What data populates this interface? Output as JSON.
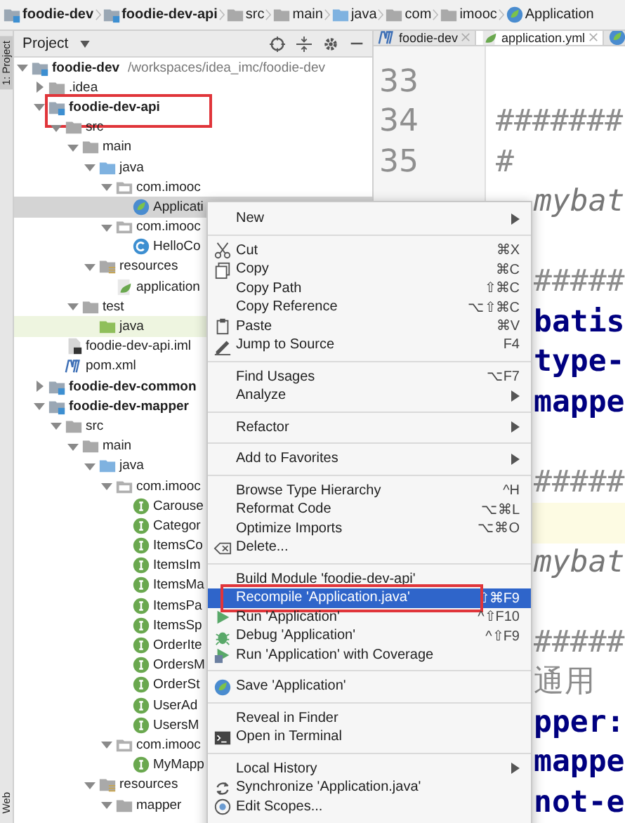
{
  "breadcrumbs": [
    {
      "label": "foodie-dev",
      "kind": "module"
    },
    {
      "label": "foodie-dev-api",
      "kind": "module"
    },
    {
      "label": "src",
      "kind": "folder"
    },
    {
      "label": "main",
      "kind": "folder"
    },
    {
      "label": "java",
      "kind": "src-folder"
    },
    {
      "label": "com",
      "kind": "folder"
    },
    {
      "label": "imooc",
      "kind": "folder"
    },
    {
      "label": "Application",
      "kind": "spring"
    }
  ],
  "tool_strip": [
    {
      "label": "1: Project",
      "selected": true
    },
    {
      "label": "Web",
      "selected": false
    }
  ],
  "project_panel": {
    "title": "Project",
    "tree": [
      {
        "label": "foodie-dev",
        "path": "/workspaces/idea_imc/foodie-dev",
        "kind": "module",
        "expanded": true,
        "selected": false,
        "children": [
          {
            "label": ".idea",
            "kind": "folder",
            "expanded": false,
            "selected": false
          },
          {
            "label": "foodie-dev-api",
            "kind": "module",
            "expanded": true,
            "selected": false,
            "marked": true,
            "children": [
              {
                "label": "src",
                "kind": "folder",
                "expanded": true,
                "selected": false,
                "children": [
                  {
                    "label": "main",
                    "kind": "folder",
                    "expanded": true,
                    "selected": false,
                    "children": [
                      {
                        "label": "java",
                        "kind": "src-folder",
                        "expanded": true,
                        "selected": false,
                        "children": [
                          {
                            "label": "com.imooc",
                            "kind": "package",
                            "expanded": true,
                            "selected": false,
                            "children": [
                              {
                                "label": "Applicati",
                                "kind": "spring",
                                "selected": true
                              }
                            ]
                          },
                          {
                            "label": "com.imooc",
                            "kind": "package",
                            "expanded": true,
                            "selected": false,
                            "children": [
                              {
                                "label": "HelloCo",
                                "kind": "class",
                                "selected": false
                              }
                            ]
                          }
                        ]
                      },
                      {
                        "label": "resources",
                        "kind": "res-folder",
                        "expanded": true,
                        "selected": false,
                        "children": [
                          {
                            "label": "application",
                            "kind": "yml",
                            "selected": false
                          }
                        ]
                      }
                    ]
                  },
                  {
                    "label": "test",
                    "kind": "folder",
                    "expanded": true,
                    "selected": false,
                    "children": [
                      {
                        "label": "java",
                        "kind": "test-folder",
                        "selected": false
                      }
                    ]
                  }
                ]
              },
              {
                "label": "foodie-dev-api.iml",
                "kind": "iml",
                "selected": false
              },
              {
                "label": "pom.xml",
                "kind": "pom",
                "selected": false
              }
            ]
          },
          {
            "label": "foodie-dev-common",
            "kind": "module",
            "expanded": false,
            "selected": false
          },
          {
            "label": "foodie-dev-mapper",
            "kind": "module",
            "expanded": true,
            "selected": false,
            "children": [
              {
                "label": "src",
                "kind": "folder",
                "expanded": true,
                "selected": false,
                "children": [
                  {
                    "label": "main",
                    "kind": "folder",
                    "expanded": true,
                    "selected": false,
                    "children": [
                      {
                        "label": "java",
                        "kind": "src-folder",
                        "expanded": true,
                        "selected": false,
                        "children": [
                          {
                            "label": "com.imooc",
                            "kind": "package",
                            "expanded": true,
                            "selected": false,
                            "children": [
                              {
                                "label": "Carouse",
                                "kind": "interface",
                                "selected": false
                              },
                              {
                                "label": "Categor",
                                "kind": "interface",
                                "selected": false
                              },
                              {
                                "label": "ItemsCo",
                                "kind": "interface",
                                "selected": false
                              },
                              {
                                "label": "ItemsIm",
                                "kind": "interface",
                                "selected": false
                              },
                              {
                                "label": "ItemsMa",
                                "kind": "interface",
                                "selected": false
                              },
                              {
                                "label": "ItemsPa",
                                "kind": "interface",
                                "selected": false
                              },
                              {
                                "label": "ItemsSp",
                                "kind": "interface",
                                "selected": false
                              },
                              {
                                "label": "OrderIte",
                                "kind": "interface",
                                "selected": false
                              },
                              {
                                "label": "OrdersM",
                                "kind": "interface",
                                "selected": false
                              },
                              {
                                "label": "OrderSt",
                                "kind": "interface",
                                "selected": false
                              },
                              {
                                "label": "UserAd",
                                "kind": "interface",
                                "selected": false
                              },
                              {
                                "label": "UsersM",
                                "kind": "interface",
                                "selected": false
                              }
                            ]
                          },
                          {
                            "label": "com.imooc",
                            "kind": "package",
                            "expanded": true,
                            "selected": false,
                            "children": [
                              {
                                "label": "MyMapp",
                                "kind": "interface",
                                "selected": false
                              }
                            ]
                          }
                        ]
                      },
                      {
                        "label": "resources",
                        "kind": "res-folder",
                        "expanded": true,
                        "selected": false,
                        "children": [
                          {
                            "label": "mapper",
                            "kind": "folder",
                            "expanded": true,
                            "selected": false
                          }
                        ]
                      }
                    ]
                  }
                ]
              }
            ]
          }
        ]
      }
    ]
  },
  "editor": {
    "tabs": [
      {
        "label": "foodie-dev",
        "kind": "maven",
        "selected": false
      },
      {
        "label": "application.yml",
        "kind": "yml",
        "selected": true
      },
      {
        "kind": "spring",
        "selected": false
      }
    ],
    "line_numbers": [
      "33",
      "34",
      "35"
    ],
    "lines": [
      {
        "kind": "blank"
      },
      {
        "kind": "comment",
        "text": "#######"
      },
      {
        "kind": "comment",
        "text": "#"
      }
    ],
    "lines_beside_menu": [
      {
        "kind": "italic",
        "text": "mybat"
      },
      {
        "kind": "blank"
      },
      {
        "kind": "comment",
        "text": "#####"
      },
      {
        "kind": "key",
        "text": "batis"
      },
      {
        "kind": "key",
        "text": "type-"
      },
      {
        "kind": "key",
        "text": "mappe"
      },
      {
        "kind": "blank"
      },
      {
        "kind": "comment",
        "text": "#####"
      },
      {
        "kind": "current"
      },
      {
        "kind": "italic",
        "text": "mybat"
      },
      {
        "kind": "blank"
      },
      {
        "kind": "comment",
        "text": "#####"
      },
      {
        "kind": "comment",
        "text": "通用"
      },
      {
        "kind": "key",
        "text": "pper:"
      },
      {
        "kind": "key",
        "text": "mappe"
      },
      {
        "kind": "key",
        "text": "not-e"
      }
    ]
  },
  "context_menu": {
    "groups": [
      [
        {
          "label": "New",
          "kind": "plain",
          "submenu": true,
          "selected": false
        }
      ],
      [
        {
          "label": "Cut",
          "shortcut": "⌘X",
          "kind": "cut",
          "selected": false
        },
        {
          "label": "Copy",
          "shortcut": "⌘C",
          "kind": "copy",
          "selected": false
        },
        {
          "label": "Copy Path",
          "shortcut": "⇧⌘C",
          "kind": "plain",
          "selected": false
        },
        {
          "label": "Copy Reference",
          "shortcut": "⌥⇧⌘C",
          "kind": "plain",
          "selected": false
        },
        {
          "label": "Paste",
          "shortcut": "⌘V",
          "kind": "paste",
          "selected": false
        },
        {
          "label": "Jump to Source",
          "shortcut": "F4",
          "kind": "edit",
          "selected": false
        }
      ],
      [
        {
          "label": "Find Usages",
          "shortcut": "⌥F7",
          "kind": "plain",
          "selected": false
        },
        {
          "label": "Analyze",
          "kind": "plain",
          "submenu": true,
          "selected": false
        }
      ],
      [
        {
          "label": "Refactor",
          "kind": "plain",
          "submenu": true,
          "selected": false
        }
      ],
      [
        {
          "label": "Add to Favorites",
          "kind": "plain",
          "submenu": true,
          "selected": false
        }
      ],
      [
        {
          "label": "Browse Type Hierarchy",
          "shortcut": "^H",
          "kind": "plain",
          "selected": false
        },
        {
          "label": "Reformat Code",
          "shortcut": "⌥⌘L",
          "kind": "plain",
          "selected": false
        },
        {
          "label": "Optimize Imports",
          "shortcut": "⌥⌘O",
          "kind": "plain",
          "selected": false
        },
        {
          "label": "Delete...",
          "kind": "delete",
          "selected": false
        }
      ],
      [
        {
          "label": "Build Module 'foodie-dev-api'",
          "kind": "plain",
          "selected": false
        },
        {
          "label": "Recompile 'Application.java'",
          "shortcut": "⇧⌘F9",
          "kind": "plain",
          "selected": true,
          "marked": true
        },
        {
          "label": "Run 'Application'",
          "shortcut": "^⇧F10",
          "kind": "run",
          "selected": false
        },
        {
          "label": "Debug 'Application'",
          "shortcut": "^⇧F9",
          "kind": "debug",
          "selected": false
        },
        {
          "label": "Run 'Application' with Coverage",
          "kind": "coverage",
          "selected": false
        }
      ],
      [
        {
          "label": "Save 'Application'",
          "kind": "spring",
          "selected": false
        }
      ],
      [
        {
          "label": "Reveal in Finder",
          "kind": "plain",
          "selected": false
        },
        {
          "label": "Open in Terminal",
          "kind": "terminal",
          "selected": false
        }
      ],
      [
        {
          "label": "Local History",
          "kind": "plain",
          "submenu": true,
          "selected": false
        },
        {
          "label": "Synchronize 'Application.java'",
          "kind": "sync",
          "selected": false
        },
        {
          "label": "Edit Scopes...",
          "kind": "scopes",
          "selected": false
        }
      ]
    ]
  }
}
